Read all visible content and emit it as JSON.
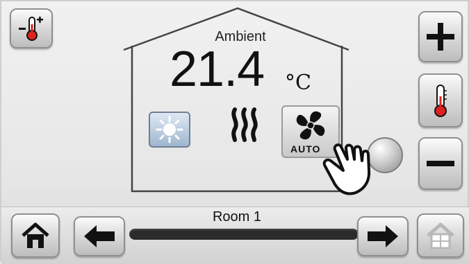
{
  "display": {
    "ambient_label": "Ambient",
    "temperature": "21.4",
    "unit": "°C"
  },
  "mode": {
    "fan_label": "AUTO"
  },
  "room": {
    "name": "Room 1"
  },
  "icons": {
    "top_left": "thermometer-minus-icon",
    "plus": "plus-icon",
    "thermometer": "thermometer-icon",
    "minus": "minus-icon",
    "home": "home-icon",
    "prev": "arrow-left-icon",
    "next": "arrow-right-icon",
    "rooms": "house-grid-icon",
    "sun": "sun-icon",
    "heater": "heater-icon",
    "fan": "fan-icon",
    "hand": "pointing-hand-icon"
  }
}
